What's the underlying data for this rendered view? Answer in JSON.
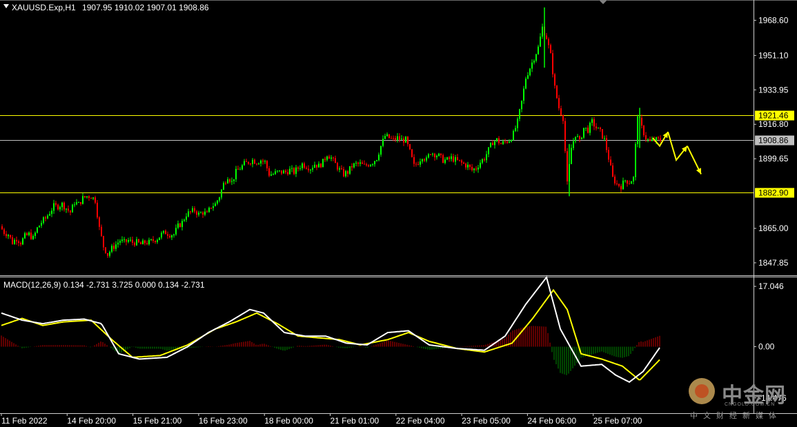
{
  "header": {
    "symbol": "XAUUSD.Exp,H1",
    "ohlc": "1907.95 1910.02 1907.01 1908.86"
  },
  "indicator": {
    "label": "MACD(12,26,9) 0.134 -2.731 3.725 0.000 0.134 -2.731"
  },
  "watermark": {
    "cn": "中金网",
    "en": "CNGOLD.COM.CN",
    "sub": "中文财经新媒体"
  },
  "colors": {
    "background": "#000000",
    "bull_candle": "#00ff00",
    "bear_candle": "#ff0000",
    "level_line": "#ffff00",
    "bid_line": "#c0c0c0",
    "macd_line": "#ffffff",
    "signal_line": "#ffff00",
    "hist_pos": "#8b0000",
    "hist_neg": "#006400",
    "arrows": "#ffff00"
  },
  "chart_data": [
    {
      "type": "candlestick",
      "symbol": "XAUUSD.Exp",
      "timeframe": "H1",
      "price_axis_ticks": [
        "1968.60",
        "1951.10",
        "1933.95",
        "1916.80",
        "1899.65",
        "1882.90",
        "1865.00",
        "1847.85"
      ],
      "ylim": [
        1842,
        1978
      ],
      "time_axis_labels": [
        "11 Feb 2022",
        "14 Feb 20:00",
        "15 Feb 21:00",
        "16 Feb 23:00",
        "18 Feb 00:00",
        "21 Feb 01:00",
        "22 Feb 04:00",
        "23 Feb 05:00",
        "24 Feb 06:00",
        "25 Feb 07:00"
      ],
      "horizontal_levels": [
        {
          "value": 1921.46,
          "label": "1921.46",
          "color": "#ffff00"
        },
        {
          "value": 1908.86,
          "label": "1908.86",
          "color": "#c0c0c0"
        },
        {
          "value": 1882.9,
          "label": "1882.90",
          "color": "#ffff00"
        }
      ],
      "close_path": [
        [
          0,
          1866
        ],
        [
          6,
          1863
        ],
        [
          12,
          1862
        ],
        [
          18,
          1858
        ],
        [
          24,
          1860
        ],
        [
          30,
          1858
        ],
        [
          36,
          1861
        ],
        [
          42,
          1862
        ],
        [
          48,
          1860
        ],
        [
          54,
          1865
        ],
        [
          60,
          1868
        ],
        [
          66,
          1870
        ],
        [
          72,
          1873
        ],
        [
          78,
          1876
        ],
        [
          84,
          1876
        ],
        [
          90,
          1877
        ],
        [
          96,
          1875
        ],
        [
          102,
          1873
        ],
        [
          108,
          1878
        ],
        [
          114,
          1877
        ],
        [
          120,
          1880
        ],
        [
          126,
          1881
        ],
        [
          132,
          1881
        ],
        [
          138,
          1879
        ],
        [
          144,
          1865
        ],
        [
          150,
          1856
        ],
        [
          156,
          1852
        ],
        [
          162,
          1855
        ],
        [
          168,
          1857
        ],
        [
          174,
          1859
        ],
        [
          180,
          1858
        ],
        [
          186,
          1859
        ],
        [
          192,
          1858
        ],
        [
          198,
          1858
        ],
        [
          204,
          1857
        ],
        [
          210,
          1858
        ],
        [
          216,
          1858
        ],
        [
          222,
          1859
        ],
        [
          228,
          1860
        ],
        [
          234,
          1862
        ],
        [
          240,
          1863
        ],
        [
          246,
          1862
        ],
        [
          252,
          1862
        ],
        [
          258,
          1866
        ],
        [
          264,
          1868
        ],
        [
          270,
          1872
        ],
        [
          276,
          1873
        ],
        [
          282,
          1874
        ],
        [
          288,
          1872
        ],
        [
          294,
          1873
        ],
        [
          300,
          1872
        ],
        [
          306,
          1876
        ],
        [
          312,
          1877
        ],
        [
          318,
          1881
        ],
        [
          324,
          1887
        ],
        [
          330,
          1891
        ],
        [
          336,
          1888
        ],
        [
          342,
          1893
        ],
        [
          348,
          1895
        ],
        [
          354,
          1897
        ],
        [
          360,
          1898
        ],
        [
          366,
          1899
        ],
        [
          372,
          1898
        ],
        [
          378,
          1899
        ],
        [
          384,
          1898
        ],
        [
          390,
          1892
        ],
        [
          396,
          1892
        ],
        [
          402,
          1893
        ],
        [
          408,
          1893
        ],
        [
          414,
          1893
        ],
        [
          420,
          1894
        ],
        [
          426,
          1893
        ],
        [
          432,
          1895
        ],
        [
          438,
          1897
        ],
        [
          444,
          1896
        ],
        [
          450,
          1895
        ],
        [
          456,
          1897
        ],
        [
          462,
          1896
        ],
        [
          468,
          1898
        ],
        [
          474,
          1902
        ],
        [
          480,
          1900
        ],
        [
          486,
          1897
        ],
        [
          492,
          1894
        ],
        [
          498,
          1892
        ],
        [
          504,
          1893
        ],
        [
          510,
          1896
        ],
        [
          516,
          1897
        ],
        [
          522,
          1897
        ],
        [
          528,
          1896
        ],
        [
          534,
          1897
        ],
        [
          540,
          1898
        ],
        [
          546,
          1900
        ],
        [
          552,
          1906
        ],
        [
          558,
          1911
        ],
        [
          564,
          1910
        ],
        [
          570,
          1909
        ],
        [
          576,
          1910
        ],
        [
          582,
          1909
        ],
        [
          588,
          1909
        ],
        [
          594,
          1903
        ],
        [
          600,
          1896
        ],
        [
          606,
          1898
        ],
        [
          612,
          1901
        ],
        [
          618,
          1899
        ],
        [
          624,
          1903
        ],
        [
          630,
          1902
        ],
        [
          636,
          1901
        ],
        [
          642,
          1899
        ],
        [
          648,
          1899
        ],
        [
          654,
          1900
        ],
        [
          660,
          1899
        ],
        [
          666,
          1898
        ],
        [
          672,
          1897
        ],
        [
          678,
          1896
        ],
        [
          684,
          1894
        ],
        [
          690,
          1895
        ],
        [
          696,
          1898
        ],
        [
          702,
          1900
        ],
        [
          708,
          1904
        ],
        [
          714,
          1908
        ],
        [
          720,
          1909
        ],
        [
          726,
          1907
        ],
        [
          732,
          1908
        ],
        [
          738,
          1909
        ],
        [
          744,
          1912
        ],
        [
          750,
          1918
        ],
        [
          756,
          1928
        ],
        [
          762,
          1940
        ],
        [
          768,
          1945
        ],
        [
          774,
          1950
        ],
        [
          780,
          1955
        ],
        [
          786,
          1965
        ],
        [
          792,
          1960
        ],
        [
          798,
          1951
        ],
        [
          804,
          1935
        ],
        [
          810,
          1925
        ],
        [
          816,
          1920
        ],
        [
          822,
          1887
        ],
        [
          828,
          1905
        ],
        [
          834,
          1912
        ],
        [
          840,
          1908
        ],
        [
          846,
          1915
        ],
        [
          852,
          1914
        ],
        [
          858,
          1918
        ],
        [
          864,
          1915
        ],
        [
          870,
          1913
        ],
        [
          876,
          1909
        ],
        [
          882,
          1900
        ],
        [
          888,
          1890
        ],
        [
          894,
          1887
        ],
        [
          900,
          1886
        ],
        [
          906,
          1889
        ],
        [
          912,
          1888
        ],
        [
          918,
          1890
        ],
        [
          924,
          1922
        ],
        [
          930,
          1915
        ],
        [
          936,
          1910
        ],
        [
          942,
          1908
        ],
        [
          948,
          1909
        ],
        [
          954,
          1909
        ]
      ],
      "projection_arrows": [
        [
          [
            946,
            1910
          ],
          [
            956,
            1906
          ],
          [
            968,
            1913
          ]
        ],
        [
          [
            968,
            1913
          ],
          [
            980,
            1899
          ],
          [
            996,
            1906
          ]
        ],
        [
          [
            996,
            1906
          ],
          [
            1016,
            1892
          ]
        ]
      ]
    },
    {
      "type": "macd",
      "params": "MACD(12,26,9)",
      "values": {
        "macd": 0.134,
        "signal": -2.731,
        "extra": [
          3.725,
          0.0,
          0.134,
          -2.731
        ]
      },
      "axis_ticks": [
        "17.046",
        "0.00",
        "-14.476"
      ],
      "ylim": [
        -18.6,
        19.6
      ],
      "macd_path": [
        [
          0,
          9.5
        ],
        [
          30,
          7.5
        ],
        [
          60,
          6.5
        ],
        [
          90,
          7.5
        ],
        [
          120,
          7.8
        ],
        [
          145,
          6.5
        ],
        [
          170,
          -2
        ],
        [
          200,
          -3.5
        ],
        [
          240,
          -3
        ],
        [
          270,
          0
        ],
        [
          300,
          4
        ],
        [
          330,
          7
        ],
        [
          360,
          10.5
        ],
        [
          380,
          9.5
        ],
        [
          410,
          4
        ],
        [
          440,
          3
        ],
        [
          470,
          3
        ],
        [
          500,
          1
        ],
        [
          530,
          0.5
        ],
        [
          560,
          4
        ],
        [
          590,
          4.5
        ],
        [
          620,
          0.5
        ],
        [
          660,
          -0.5
        ],
        [
          700,
          -1
        ],
        [
          730,
          3
        ],
        [
          760,
          12
        ],
        [
          790,
          19.6
        ],
        [
          810,
          5
        ],
        [
          840,
          -5.5
        ],
        [
          870,
          -5
        ],
        [
          890,
          -8
        ],
        [
          910,
          -10
        ],
        [
          930,
          -7
        ],
        [
          955,
          0
        ]
      ],
      "signal_path": [
        [
          0,
          6
        ],
        [
          30,
          8
        ],
        [
          60,
          6
        ],
        [
          90,
          7
        ],
        [
          130,
          7.5
        ],
        [
          160,
          2
        ],
        [
          190,
          -3
        ],
        [
          230,
          -2.5
        ],
        [
          270,
          0.5
        ],
        [
          310,
          5
        ],
        [
          340,
          7
        ],
        [
          370,
          9.5
        ],
        [
          400,
          6.5
        ],
        [
          430,
          3
        ],
        [
          460,
          2.5
        ],
        [
          490,
          2
        ],
        [
          520,
          0.5
        ],
        [
          560,
          2
        ],
        [
          590,
          4
        ],
        [
          620,
          1.5
        ],
        [
          660,
          -0.5
        ],
        [
          700,
          -1.5
        ],
        [
          740,
          1
        ],
        [
          770,
          8
        ],
        [
          800,
          16
        ],
        [
          820,
          10.5
        ],
        [
          840,
          -2
        ],
        [
          870,
          -3.5
        ],
        [
          900,
          -5.5
        ],
        [
          925,
          -9.5
        ],
        [
          955,
          -3.5
        ]
      ],
      "histogram_pos_segments": [
        [
          0,
          30
        ],
        [
          80,
          135
        ],
        [
          230,
          370
        ],
        [
          520,
          590
        ],
        [
          700,
          790
        ],
        [
          850,
          875
        ],
        [
          925,
          955
        ]
      ],
      "histogram_neg_segments": [
        [
          30,
          75
        ],
        [
          140,
          175
        ],
        [
          380,
          460
        ],
        [
          595,
          640
        ],
        [
          800,
          835
        ],
        [
          880,
          920
        ]
      ]
    }
  ]
}
